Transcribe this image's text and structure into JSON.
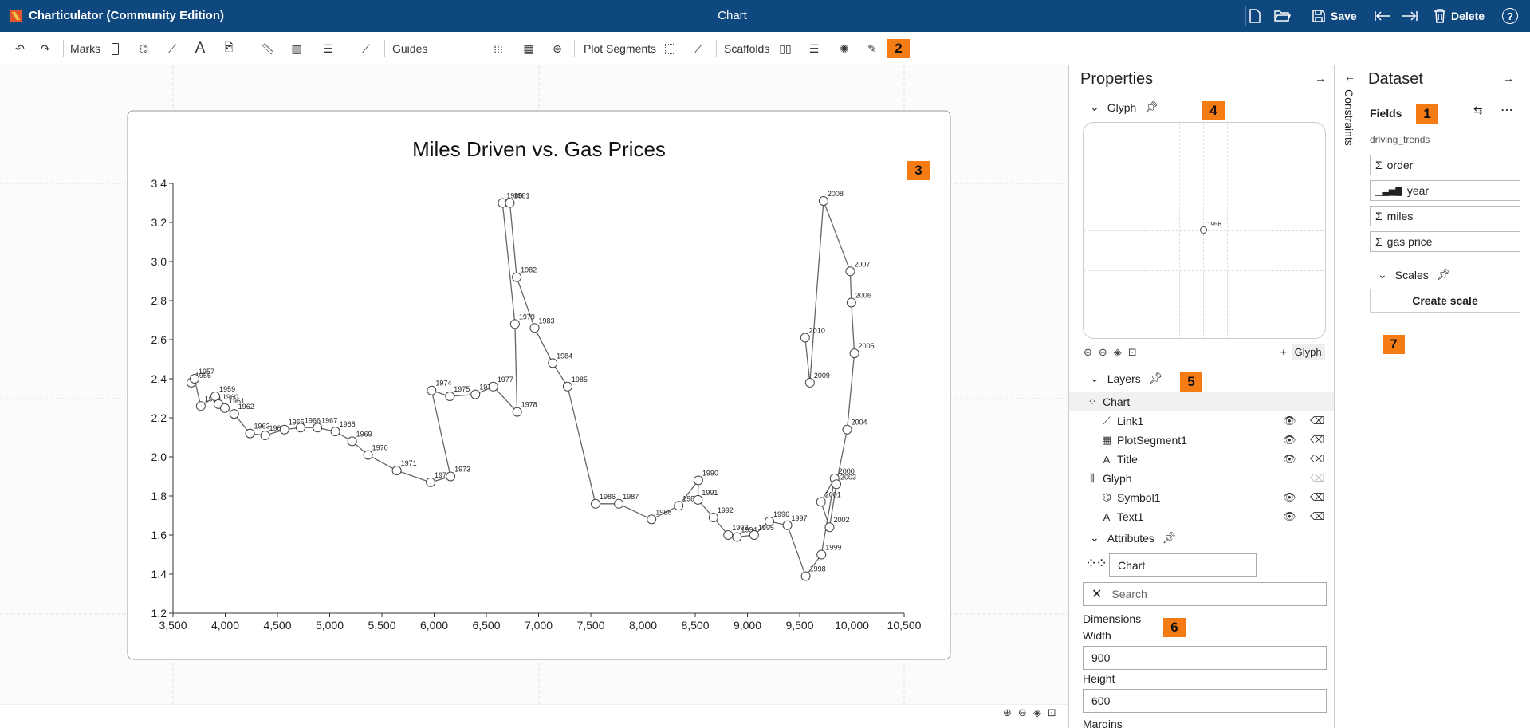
{
  "app": {
    "name": "Charticulator (Community Edition)",
    "document_title": "Chart"
  },
  "titlebar": {
    "save_label": "Save",
    "delete_label": "Delete",
    "help": "?"
  },
  "toolbar": {
    "marks_label": "Marks",
    "guides_label": "Guides",
    "plot_segments_label": "Plot Segments",
    "scaffolds_label": "Scaffolds"
  },
  "badges": [
    "1",
    "2",
    "3",
    "4",
    "5",
    "6",
    "7"
  ],
  "chart_data": {
    "type": "scatter",
    "title": "Miles Driven vs. Gas Prices",
    "xlim": [
      3500,
      10500
    ],
    "ylim": [
      1.2,
      3.4
    ],
    "xticks": [
      "3,500",
      "4,000",
      "4,500",
      "5,000",
      "5,500",
      "6,000",
      "6,500",
      "7,000",
      "7,500",
      "8,000",
      "8,500",
      "9,000",
      "9,500",
      "10,000",
      "10,500"
    ],
    "yticks": [
      "1.2",
      "1.4",
      "1.6",
      "1.8",
      "2.0",
      "2.2",
      "2.4",
      "2.6",
      "2.8",
      "3.0",
      "3.2",
      "3.4"
    ],
    "connected": true,
    "points": [
      {
        "year": "1956",
        "x": 3675,
        "y": 2.38
      },
      {
        "year": "1957",
        "x": 3706,
        "y": 2.4
      },
      {
        "year": "1958",
        "x": 3766,
        "y": 2.26
      },
      {
        "year": "1959",
        "x": 3905,
        "y": 2.31
      },
      {
        "year": "1960",
        "x": 3935,
        "y": 2.27
      },
      {
        "year": "1961",
        "x": 3996,
        "y": 2.25
      },
      {
        "year": "1962",
        "x": 4086,
        "y": 2.22
      },
      {
        "year": "1963",
        "x": 4237,
        "y": 2.12
      },
      {
        "year": "1964",
        "x": 4382,
        "y": 2.11
      },
      {
        "year": "1965",
        "x": 4567,
        "y": 2.14
      },
      {
        "year": "1966",
        "x": 4721,
        "y": 2.15
      },
      {
        "year": "1967",
        "x": 4883,
        "y": 2.15
      },
      {
        "year": "1968",
        "x": 5054,
        "y": 2.13
      },
      {
        "year": "1969",
        "x": 5215,
        "y": 2.08
      },
      {
        "year": "1970",
        "x": 5367,
        "y": 2.01
      },
      {
        "year": "1971",
        "x": 5642,
        "y": 1.93
      },
      {
        "year": "1972",
        "x": 5966,
        "y": 1.87
      },
      {
        "year": "1973",
        "x": 6157,
        "y": 1.9
      },
      {
        "year": "1974",
        "x": 5976,
        "y": 2.34
      },
      {
        "year": "1975",
        "x": 6151,
        "y": 2.31
      },
      {
        "year": "1976",
        "x": 6395,
        "y": 2.32
      },
      {
        "year": "1977",
        "x": 6567,
        "y": 2.36
      },
      {
        "year": "1978",
        "x": 6795,
        "y": 2.23
      },
      {
        "year": "1979",
        "x": 6774,
        "y": 2.68
      },
      {
        "year": "1980",
        "x": 6655,
        "y": 3.3
      },
      {
        "year": "1981",
        "x": 6725,
        "y": 3.3
      },
      {
        "year": "1982",
        "x": 6791,
        "y": 2.92
      },
      {
        "year": "1983",
        "x": 6962,
        "y": 2.66
      },
      {
        "year": "1984",
        "x": 7135,
        "y": 2.48
      },
      {
        "year": "1985",
        "x": 7278,
        "y": 2.36
      },
      {
        "year": "1986",
        "x": 7546,
        "y": 1.76
      },
      {
        "year": "1987",
        "x": 7768,
        "y": 1.76
      },
      {
        "year": "1988",
        "x": 8082,
        "y": 1.68
      },
      {
        "year": "1989",
        "x": 8341,
        "y": 1.75
      },
      {
        "year": "1990",
        "x": 8530,
        "y": 1.88
      },
      {
        "year": "1991",
        "x": 8526,
        "y": 1.78
      },
      {
        "year": "1992",
        "x": 8674,
        "y": 1.69
      },
      {
        "year": "1993",
        "x": 8815,
        "y": 1.6
      },
      {
        "year": "1994",
        "x": 8900,
        "y": 1.59
      },
      {
        "year": "1995",
        "x": 9064,
        "y": 1.6
      },
      {
        "year": "1996",
        "x": 9210,
        "y": 1.67
      },
      {
        "year": "1997",
        "x": 9382,
        "y": 1.65
      },
      {
        "year": "1998",
        "x": 9558,
        "y": 1.39
      },
      {
        "year": "1999",
        "x": 9708,
        "y": 1.5
      },
      {
        "year": "2000",
        "x": 9834,
        "y": 1.89
      },
      {
        "year": "2001",
        "x": 9704,
        "y": 1.77
      },
      {
        "year": "2002",
        "x": 9786,
        "y": 1.64
      },
      {
        "year": "2003",
        "x": 9851,
        "y": 1.86
      },
      {
        "year": "2004",
        "x": 9954,
        "y": 2.14
      },
      {
        "year": "2005",
        "x": 10024,
        "y": 2.53
      },
      {
        "year": "2006",
        "x": 9995,
        "y": 2.79
      },
      {
        "year": "2007",
        "x": 9984,
        "y": 2.95
      },
      {
        "year": "2008",
        "x": 9728,
        "y": 3.31
      },
      {
        "year": "2009",
        "x": 9598,
        "y": 2.38
      },
      {
        "year": "2010",
        "x": 9552,
        "y": 2.61
      }
    ]
  },
  "properties": {
    "title": "Properties",
    "glyph_section": "Glyph",
    "glyph_preview_point": "1956",
    "add_glyph": "Glyph",
    "layers_section": "Layers",
    "layers": [
      {
        "name": "Chart",
        "icon": "chart-icon",
        "level": 0
      },
      {
        "name": "Link1",
        "icon": "link-icon",
        "level": 1
      },
      {
        "name": "PlotSegment1",
        "icon": "grid-icon",
        "level": 1
      },
      {
        "name": "Title",
        "icon": "text-icon",
        "level": 1
      },
      {
        "name": "Glyph",
        "icon": "glyph-icon",
        "level": 0
      },
      {
        "name": "Symbol1",
        "icon": "symbol-icon",
        "level": 1
      },
      {
        "name": "Text1",
        "icon": "text-icon",
        "level": 1
      }
    ],
    "attributes_section": "Attributes",
    "attributes_name": "Chart",
    "search_placeholder": "Search",
    "dimensions_label": "Dimensions",
    "width_label": "Width",
    "width_value": "900",
    "height_label": "Height",
    "height_value": "600",
    "margins_label": "Margins"
  },
  "constraints": {
    "label": "Constraints"
  },
  "dataset": {
    "title": "Dataset",
    "fields_label": "Fields",
    "table_name": "driving_trends",
    "fields": [
      {
        "name": "order",
        "type": "numeric"
      },
      {
        "name": "year",
        "type": "ordinal"
      },
      {
        "name": "miles",
        "type": "numeric"
      },
      {
        "name": "gas price",
        "type": "numeric"
      }
    ],
    "scales_label": "Scales",
    "create_scale_label": "Create scale"
  }
}
